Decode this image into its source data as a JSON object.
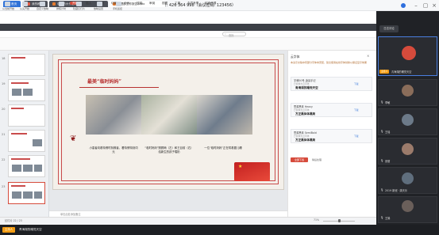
{
  "meeting": {
    "title": "腾讯会议 会议号: 426 364 998（会议密码: 123456）",
    "side_tab_label": "日志评论",
    "speaker_badge": "主持人",
    "speaker_name": "青海湖的睡觉天空"
  },
  "wps": {
    "tabs": [
      "首页",
      "我的稿壳",
      "中西药大作业.pptx",
      "护理部工作报告.pptx"
    ],
    "menu": [
      "开始",
      "插入",
      "设计",
      "切换",
      "动画",
      "放映",
      "审阅",
      "视图",
      "工具",
      "会员专享",
      "稻壳资源"
    ],
    "menu_active": "开始",
    "search_placeholder": "查找",
    "ribbon_labels": [
      "从当前开始",
      "从头开始",
      "自定义放映",
      "排练计时",
      "隐藏幻灯片",
      "放映设置",
      "手机遥控"
    ]
  },
  "thumbs": {
    "numbers": [
      "18",
      "19",
      "20",
      "21",
      "22",
      "23"
    ]
  },
  "slide": {
    "title": "最美“临时妈妈”",
    "captions": [
      "小患者向着特情时刻救者，看特情特刻词元",
      "“临时妈妈”照顾两（左）和王目前（右）给新生的孩子喂奶",
      "一位“临时妈妈”正在哄着婴儿睡"
    ],
    "notes_placeholder": "单击此处添加备注"
  },
  "font_panel": {
    "title": "云字体",
    "notice": "本演示文稿中有部分字体未安装，建议使用在线字体替换以保证显示效果",
    "cards": [
      {
        "name": "字魂50号-凌晨手记",
        "sub": "已替换为云字体",
        "preview": "青海湖的睡觉天空",
        "action": "下载"
      },
      {
        "name": "思源黑体 Heavy",
        "sub": "已替换为云字体",
        "preview": "方正黑体体黑简",
        "action": "下载"
      },
      {
        "name": "思源黑体 SemiBold",
        "sub": "已替换为云字体",
        "preview": "方正黑体体黑简",
        "action": "下载"
      }
    ],
    "primary_button": "全部下载",
    "secondary_button": "稍后处理"
  },
  "status": {
    "left": "幻灯片 22 / 23",
    "zoom": "71%"
  },
  "participants": [
    {
      "name": "青海湖的睡觉天空",
      "role": "主持人",
      "color": "#d64b3c"
    },
    {
      "name": "李敏",
      "color": "#8a6d5a"
    },
    {
      "name": "王瑶",
      "color": "#6c7a89"
    },
    {
      "name": "张丽",
      "color": "#9b7b6b"
    },
    {
      "name": "刘护士",
      "color": "#5f6e7d"
    },
    {
      "name": "2019 新冠 · 唐天乐",
      "color": "#7d6f63"
    },
    {
      "name": "王娟",
      "color": "#6a5f5a"
    }
  ],
  "colors": {
    "accent": "#d64b3c",
    "blue": "#2f72d8"
  }
}
